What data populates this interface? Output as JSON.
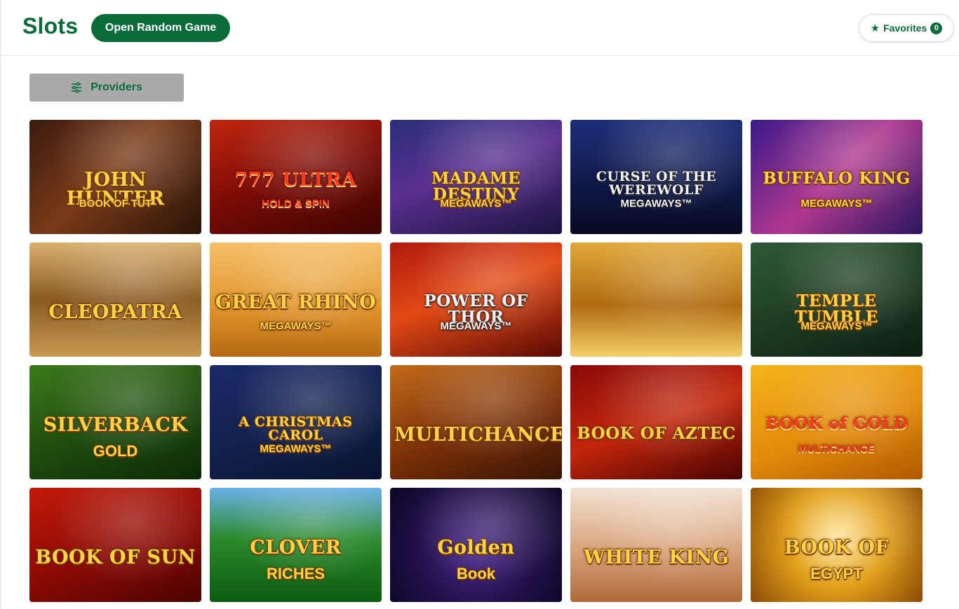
{
  "header": {
    "title": "Slots",
    "random_label": "Open Random Game",
    "favorites_label": "Favorites",
    "favorites_count": "0"
  },
  "filters": {
    "providers_label": "Providers"
  },
  "colors": {
    "brand_green": "#0b6b3a",
    "providers_bg": "#a9a9a9"
  },
  "games": [
    {
      "title": "JOHN HUNTER",
      "sub": "BOOK OF TUT",
      "bg": "linear-gradient(135deg,#3a1a10 0%,#7a3a18 45%,#2a1408 100%)",
      "style": "gold"
    },
    {
      "title": "777 ULTRA",
      "sub": "HOLD & SPIN",
      "bg": "linear-gradient(160deg,#c2260f 0%,#7a0b05 50%,#3c0501 100%)",
      "style": "red"
    },
    {
      "title": "MADAME DESTINY",
      "sub": "MEGAWAYS™",
      "bg": "linear-gradient(160deg,#2a2f7a 0%,#5a2f8f 45%,#1b1440 100%)",
      "style": "gold"
    },
    {
      "title": "CURSE OF THE WEREWOLF",
      "sub": "MEGAWAYS™",
      "bg": "linear-gradient(180deg,#1c2f7a 0%,#101a4a 55%,#070a22 100%)",
      "style": "silver"
    },
    {
      "title": "BUFFALO KING",
      "sub": "MEGAWAYS™",
      "bg": "linear-gradient(135deg,#3a1a8a 0%,#b0388f 50%,#2a1660 100%)",
      "style": "gold"
    },
    {
      "title": "CLEOPATRA",
      "sub": "",
      "bg": "linear-gradient(180deg,#d8b070 0%,#8a5a22 50%,#c79a52 100%)",
      "style": "gold"
    },
    {
      "title": "GREAT RHINO",
      "sub": "MEGAWAYS™",
      "bg": "linear-gradient(180deg,#f5c06a 0%,#e2962e 55%,#b86a12 100%)",
      "style": "gold"
    },
    {
      "title": "POWER OF THOR",
      "sub": "MEGAWAYS™",
      "bg": "linear-gradient(160deg,#b01a10 0%,#e24a14 45%,#5a0a06 100%)",
      "style": "silver"
    },
    {
      "title": "",
      "sub": "",
      "bg": "linear-gradient(180deg,#e0a83a 0%,#b06a10 55%,#f5cf68 100%)",
      "style": "gold"
    },
    {
      "title": "TEMPLE TUMBLE",
      "sub": "MEGAWAYS™",
      "bg": "linear-gradient(160deg,#2f5a36 0%,#1c3a22 55%,#0c1e12 100%)",
      "style": "gold"
    },
    {
      "title": "SILVERBACK",
      "sub": "GOLD",
      "bg": "linear-gradient(160deg,#3c7a1c 0%,#1e4a0e 55%,#0c2a06 100%)",
      "style": "gold"
    },
    {
      "title": "A CHRISTMAS CAROL",
      "sub": "MEGAWAYS™",
      "bg": "linear-gradient(160deg,#1a2a6a 0%,#12204a 55%,#0a1230 100%)",
      "style": "gold"
    },
    {
      "title": "MULTICHANCE",
      "sub": "",
      "bg": "linear-gradient(160deg,#c26a1a 0%,#7a3008 55%,#3a1404 100%)",
      "style": "gold"
    },
    {
      "title": "BOOK OF AZTEC",
      "sub": "",
      "bg": "linear-gradient(160deg,#8a0a0a 0%,#c2260a 50%,#4a0404 100%)",
      "style": "gold"
    },
    {
      "title": "BOOK of GOLD",
      "sub": "MULTICHANCE",
      "bg": "linear-gradient(160deg,#f5b41a 0%,#e28a0a 55%,#b05a02 100%)",
      "style": "red"
    },
    {
      "title": "BOOK OF SUN",
      "sub": "",
      "bg": "linear-gradient(160deg,#c21a0a 0%,#8a0a04 55%,#4a0402 100%)",
      "style": "gold"
    },
    {
      "title": "CLOVER",
      "sub": "RICHES",
      "bg": "linear-gradient(180deg,#6ab0e8 0%,#2a8a2a 45%,#0e5a12 100%)",
      "style": "gold"
    },
    {
      "title": "Golden",
      "sub": "Book",
      "bg": "radial-gradient(circle at 50% 55%,#4a2a8a 0%,#22104a 55%,#0c0624 100%)",
      "style": "gold"
    },
    {
      "title": "WHITE KING",
      "sub": "",
      "bg": "linear-gradient(180deg,#f2e2d2 0%,#d8a27a 55%,#b06a3a 100%)",
      "style": "gold"
    },
    {
      "title": "BOOK OF",
      "sub": "EGYPT",
      "bg": "radial-gradient(circle at 50% 45%,#ffe8a0 0%,#e2a01a 45%,#8a4a06 100%)",
      "style": "gold"
    }
  ]
}
